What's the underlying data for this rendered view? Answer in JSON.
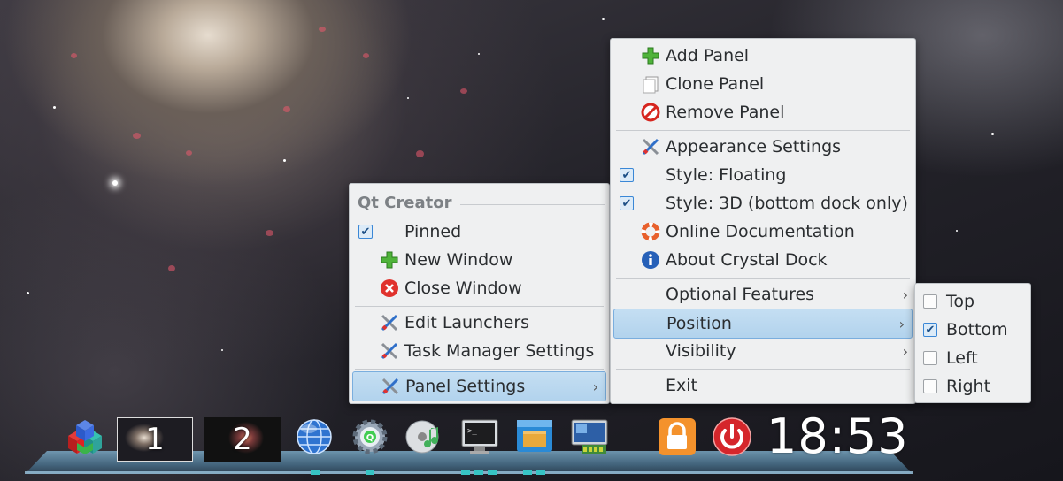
{
  "task_menu": {
    "title": "Qt Creator",
    "pinned": "Pinned",
    "new_window": "New Window",
    "close_window": "Close Window",
    "edit_launchers": "Edit Launchers",
    "task_manager_settings": "Task Manager Settings",
    "panel_settings": "Panel Settings"
  },
  "panel_menu": {
    "add_panel": "Add Panel",
    "clone_panel": "Clone Panel",
    "remove_panel": "Remove Panel",
    "appearance_settings": "Appearance Settings",
    "style_floating": "Style: Floating",
    "style_3d": "Style: 3D (bottom dock only)",
    "online_documentation": "Online Documentation",
    "about": "About Crystal Dock",
    "optional_features": "Optional Features",
    "position": "Position",
    "visibility": "Visibility",
    "exit": "Exit"
  },
  "position_menu": {
    "top": "Top",
    "bottom": "Bottom",
    "left": "Left",
    "right": "Right",
    "selected": "Bottom"
  },
  "checks": {
    "pinned": true,
    "style_floating": true,
    "style_3d": true,
    "top": false,
    "bottom": true,
    "left": false,
    "right": false
  },
  "dock": {
    "workspaces": [
      "1",
      "2"
    ],
    "clock": "18:53"
  },
  "colors": {
    "menu_bg": "#eff0f1",
    "highlight": "#b8d7ef",
    "indicator": "#37c4c4"
  }
}
